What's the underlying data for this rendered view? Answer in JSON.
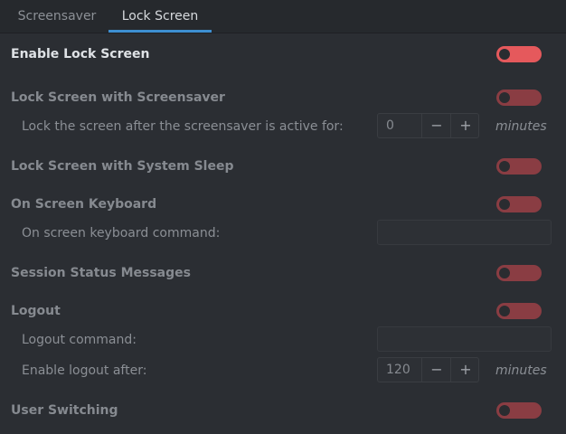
{
  "tabs": [
    {
      "label": "Screensaver"
    },
    {
      "label": "Lock Screen"
    }
  ],
  "settings": {
    "enable_lock_screen": {
      "label": "Enable Lock Screen",
      "enabled": true
    },
    "lock_with_screensaver": {
      "label": "Lock Screen with Screensaver",
      "enabled": false
    },
    "lock_after": {
      "label": "Lock the screen after the screensaver is active for:",
      "value": "0",
      "minus": "−",
      "plus": "+",
      "unit": "minutes"
    },
    "lock_with_sleep": {
      "label": "Lock Screen with System Sleep",
      "enabled": false
    },
    "on_screen_keyboard": {
      "label": "On Screen Keyboard",
      "enabled": false
    },
    "osk_command": {
      "label": "On screen keyboard command:",
      "value": ""
    },
    "session_status": {
      "label": "Session Status Messages",
      "enabled": false
    },
    "logout": {
      "label": "Logout",
      "enabled": false
    },
    "logout_command": {
      "label": "Logout command:",
      "value": ""
    },
    "logout_after": {
      "label": "Enable logout after:",
      "value": "120",
      "minus": "−",
      "plus": "+",
      "unit": "minutes"
    },
    "user_switching": {
      "label": "User Switching",
      "enabled": false
    }
  },
  "colors": {
    "accent": "#3d8fd1",
    "toggle_on": "#e5595c",
    "toggle_off": "#8a3d43"
  }
}
